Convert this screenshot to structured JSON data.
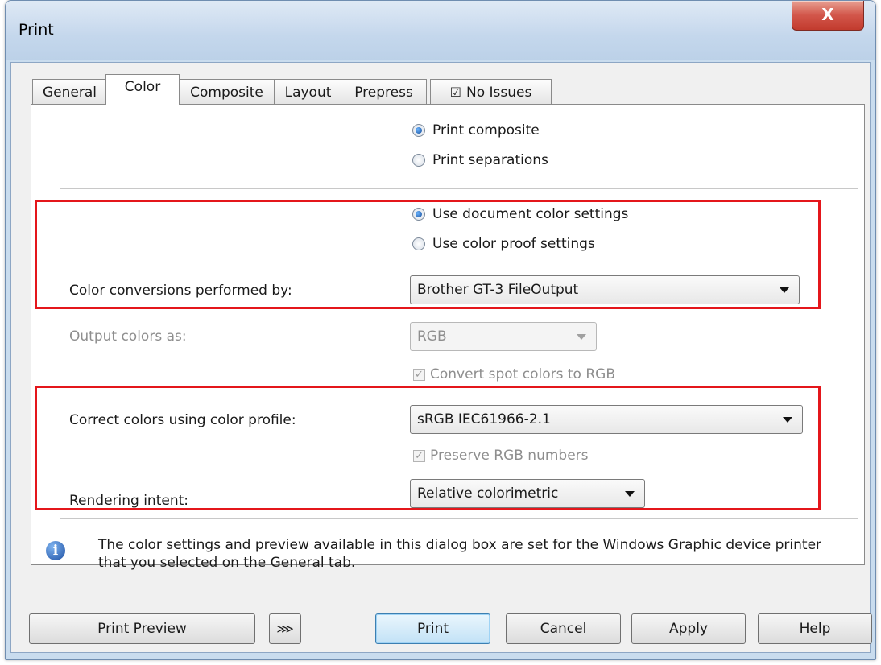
{
  "window": {
    "title": "Print",
    "close_glyph": "X"
  },
  "tabs": [
    {
      "label": "General"
    },
    {
      "label": "Color"
    },
    {
      "label": "Composite"
    },
    {
      "label": "Layout"
    },
    {
      "label": "Prepress"
    },
    {
      "label": "No Issues",
      "icon": "checklist-icon"
    }
  ],
  "active_tab": "Color",
  "print_mode": {
    "options": [
      "Print composite",
      "Print separations"
    ],
    "selected": "Print composite"
  },
  "color_settings": {
    "options": [
      "Use document color settings",
      "Use color proof settings"
    ],
    "selected": "Use document color settings"
  },
  "fields": {
    "conversions_label": "Color conversions performed by:",
    "conversions_value": "Brother GT-3 FileOutput",
    "output_label": "Output colors as:",
    "output_value": "RGB",
    "convert_spot_label": "Convert spot colors to RGB",
    "profile_label": "Correct colors using color profile:",
    "profile_value": "sRGB IEC61966-2.1",
    "preserve_label": "Preserve RGB numbers",
    "intent_label": "Rendering intent:",
    "intent_value": "Relative colorimetric"
  },
  "info": {
    "icon": "info-icon",
    "text": "The color settings and preview available in this dialog box are set for the Windows Graphic device printer that you selected on the General tab."
  },
  "buttons": {
    "print_preview": "Print Preview",
    "expand_glyph": "⋙",
    "print": "Print",
    "cancel": "Cancel",
    "apply": "Apply",
    "help": "Help"
  },
  "colors": {
    "highlight": "#e4161b",
    "titlebar": "#c4d7ec",
    "close": "#d2564a"
  }
}
